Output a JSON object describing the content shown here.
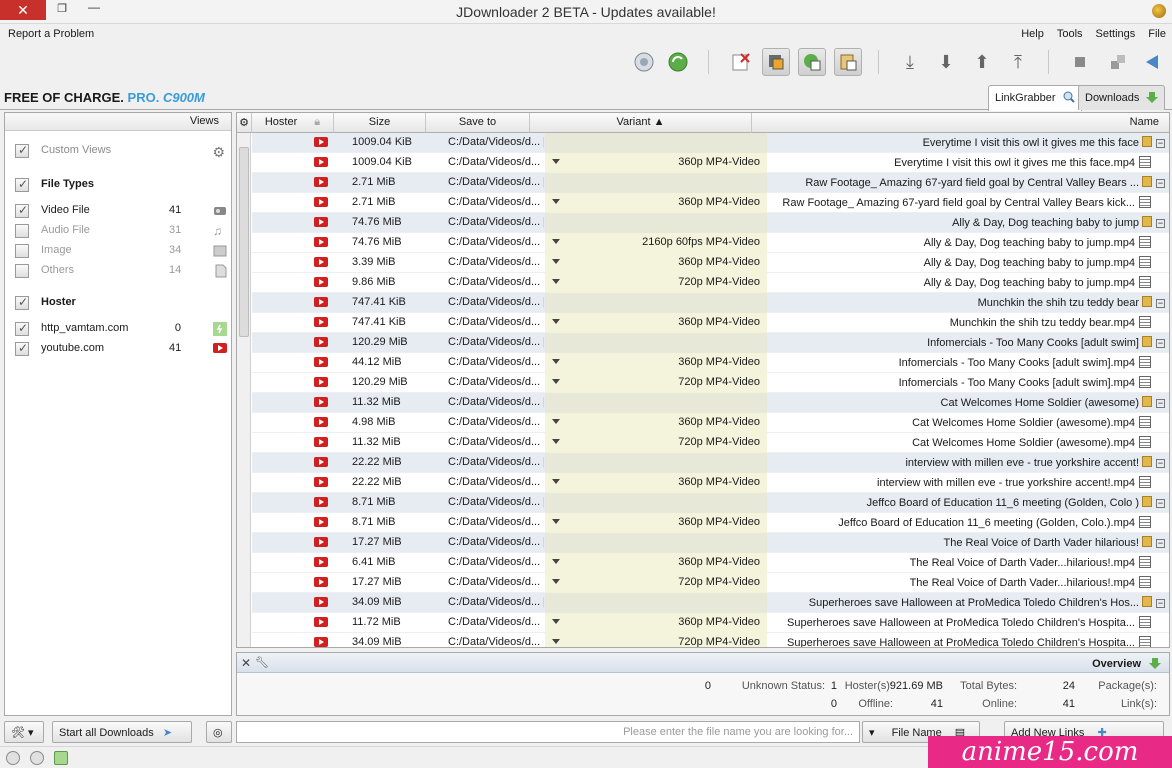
{
  "window": {
    "title": "JDownloader 2 BETA - Updates available!"
  },
  "menu": {
    "items": [
      "File",
      "Settings",
      "Tools",
      "Help"
    ],
    "report": "Report a Problem"
  },
  "banner": {
    "brand": "C900M",
    "pro": "PRO.",
    "free": "FREE OF CHARGE."
  },
  "tabs": {
    "downloads": "Downloads",
    "linkgrabber": "LinkGrabber"
  },
  "sidebar": {
    "header": "Views",
    "custom_views": "Custom Views",
    "file_types_title": "File Types",
    "file_types": [
      {
        "label": "Video File",
        "count": "41",
        "checked": true
      },
      {
        "label": "Audio File",
        "count": "31",
        "checked": false
      },
      {
        "label": "Image",
        "count": "34",
        "checked": false
      },
      {
        "label": "Others",
        "count": "14",
        "checked": false
      }
    ],
    "hoster_title": "Hoster",
    "hosters": [
      {
        "label": "http_vamtam.com",
        "count": "0"
      },
      {
        "label": "youtube.com",
        "count": "41"
      }
    ]
  },
  "table": {
    "columns": {
      "name": "Name",
      "variant": "Variant",
      "save_to": "Save to",
      "size": "Size",
      "hoster": "Hoster"
    },
    "rows": [
      {
        "type": "pkg",
        "name": "Everytime I visit this owl it gives me this face",
        "variant": "",
        "save": "C:/Data/Videos/d... [1]",
        "size": "1009.04 KiB"
      },
      {
        "type": "file",
        "name": "Everytime I visit this owl it gives me this face.mp4",
        "variant": "360p MP4-Video",
        "save": "C:/Data/Videos/d...",
        "size": "1009.04 KiB"
      },
      {
        "type": "pkg",
        "name": "Raw Footage_ Amazing 67-yard field goal by Central Valley Bears ...",
        "variant": "",
        "save": "C:/Data/Videos/d... [1]",
        "size": "2.71 MiB"
      },
      {
        "type": "file",
        "name": "Raw Footage_ Amazing 67-yard field goal by Central Valley Bears kick...",
        "variant": "360p MP4-Video",
        "save": "C:/Data/Videos/d...",
        "size": "2.71 MiB"
      },
      {
        "type": "pkg",
        "name": "Ally & Day, Dog teaching baby to jump",
        "variant": "",
        "save": "C:/Data/Videos/d... [3]",
        "size": "74.76 MiB"
      },
      {
        "type": "file",
        "name": "Ally & Day, Dog teaching baby to jump.mp4",
        "variant": "2160p 60fps MP4-Video",
        "save": "C:/Data/Videos/d...",
        "size": "74.76 MiB"
      },
      {
        "type": "file",
        "name": "Ally & Day, Dog teaching baby to jump.mp4",
        "variant": "360p MP4-Video",
        "save": "C:/Data/Videos/d...",
        "size": "3.39 MiB"
      },
      {
        "type": "file",
        "name": "Ally & Day, Dog teaching baby to jump.mp4",
        "variant": "720p MP4-Video",
        "save": "C:/Data/Videos/d...",
        "size": "9.86 MiB"
      },
      {
        "type": "pkg",
        "name": "Munchkin the shih tzu teddy bear",
        "variant": "",
        "save": "C:/Data/Videos/d... [1]",
        "size": "747.41 KiB"
      },
      {
        "type": "file",
        "name": "Munchkin the shih tzu teddy bear.mp4",
        "variant": "360p MP4-Video",
        "save": "C:/Data/Videos/d...",
        "size": "747.41 KiB"
      },
      {
        "type": "pkg",
        "name": "Infomercials - Too Many Cooks [adult swim]",
        "variant": "",
        "save": "C:/Data/Videos/d... [2]",
        "size": "120.29 MiB"
      },
      {
        "type": "file",
        "name": "Infomercials - Too Many Cooks [adult swim].mp4",
        "variant": "360p MP4-Video",
        "save": "C:/Data/Videos/d...",
        "size": "44.12 MiB"
      },
      {
        "type": "file",
        "name": "Infomercials - Too Many Cooks [adult swim].mp4",
        "variant": "720p MP4-Video",
        "save": "C:/Data/Videos/d...",
        "size": "120.29 MiB"
      },
      {
        "type": "pkg",
        "name": "Cat Welcomes Home Soldier (awesome)",
        "variant": "",
        "save": "C:/Data/Videos/d... [2]",
        "size": "11.32 MiB"
      },
      {
        "type": "file",
        "name": "Cat Welcomes Home Soldier (awesome).mp4",
        "variant": "360p MP4-Video",
        "save": "C:/Data/Videos/d...",
        "size": "4.98 MiB"
      },
      {
        "type": "file",
        "name": "Cat Welcomes Home Soldier (awesome).mp4",
        "variant": "720p MP4-Video",
        "save": "C:/Data/Videos/d...",
        "size": "11.32 MiB"
      },
      {
        "type": "pkg",
        "name": "interview with millen eve - true yorkshire accent!",
        "variant": "",
        "save": "C:/Data/Videos/d... [1]",
        "size": "22.22 MiB"
      },
      {
        "type": "file",
        "name": "interview with millen eve - true yorkshire accent!.mp4",
        "variant": "360p MP4-Video",
        "save": "C:/Data/Videos/d...",
        "size": "22.22 MiB"
      },
      {
        "type": "pkg",
        "name": "Jeffco Board of Education 11_6 meeting (Golden, Colo )",
        "variant": "",
        "save": "C:/Data/Videos/d... [1]",
        "size": "8.71 MiB"
      },
      {
        "type": "file",
        "name": "Jeffco Board of Education 11_6 meeting (Golden, Colo.).mp4",
        "variant": "360p MP4-Video",
        "save": "C:/Data/Videos/d...",
        "size": "8.71 MiB"
      },
      {
        "type": "pkg",
        "name": "The Real Voice of Darth Vader hilarious!",
        "variant": "",
        "save": "C:/Data/Videos/d... [2]",
        "size": "17.27 MiB"
      },
      {
        "type": "file",
        "name": "The Real Voice of Darth Vader...hilarious!.mp4",
        "variant": "360p MP4-Video",
        "save": "C:/Data/Videos/d...",
        "size": "6.41 MiB"
      },
      {
        "type": "file",
        "name": "The Real Voice of Darth Vader...hilarious!.mp4",
        "variant": "720p MP4-Video",
        "save": "C:/Data/Videos/d...",
        "size": "17.27 MiB"
      },
      {
        "type": "pkg",
        "name": "Superheroes save Halloween at ProMedica Toledo Children's Hos...",
        "variant": "",
        "save": "C:/Data/Videos/d... [2]",
        "size": "34.09 MiB"
      },
      {
        "type": "file",
        "name": "Superheroes save Halloween at ProMedica Toledo Children's Hospita...",
        "variant": "360p MP4-Video",
        "save": "C:/Data/Videos/d...",
        "size": "11.72 MiB"
      },
      {
        "type": "file",
        "name": "Superheroes save Halloween at ProMedica Toledo Children's Hospita...",
        "variant": "720p MP4-Video",
        "save": "C:/Data/Videos/d...",
        "size": "34.09 MiB"
      }
    ]
  },
  "overview": {
    "title": "Overview",
    "packages_label": "Package(s):",
    "packages": "24",
    "total_bytes_label": "Total Bytes:",
    "total_bytes": "921.69 MB",
    "hosters_label": "Hoster(s):",
    "hosters": "1",
    "unknown_label": "Unknown Status:",
    "unknown": "0",
    "links_label": "Link(s):",
    "links": "41",
    "online_label": "Online:",
    "online": "41",
    "offline_label": "Offline:",
    "offline": "0"
  },
  "bottom": {
    "add_links": "Add New Links",
    "filter": "File Name",
    "search_placeholder": "Please enter the file name you are looking for...",
    "start_all": "Start all Downloads"
  },
  "watermark": "anime15.com"
}
